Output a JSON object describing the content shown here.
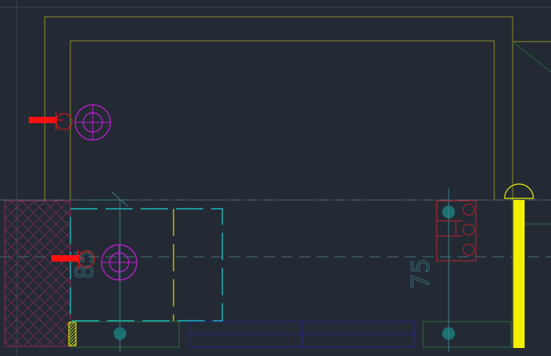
{
  "app": {
    "view": "cad-model-space"
  },
  "colors": {
    "background": "#232a34",
    "wall_outline": "#8c8c2a",
    "grid_dim": "#44555e",
    "centerline": "#3e6d78",
    "dimension": "#3b7f84",
    "magenta": "#c21fd2",
    "red": "#ff1010",
    "cyan": "#18d2d8",
    "yellow": "#f0f000",
    "teal": "#1c6f72",
    "blue": "#24268c",
    "green": "#2c6b3a",
    "crosshatch": "#7a2b54",
    "redbox": "#c2202a"
  },
  "dimensions": {
    "left_vertical": "85",
    "right_vertical": "75"
  }
}
